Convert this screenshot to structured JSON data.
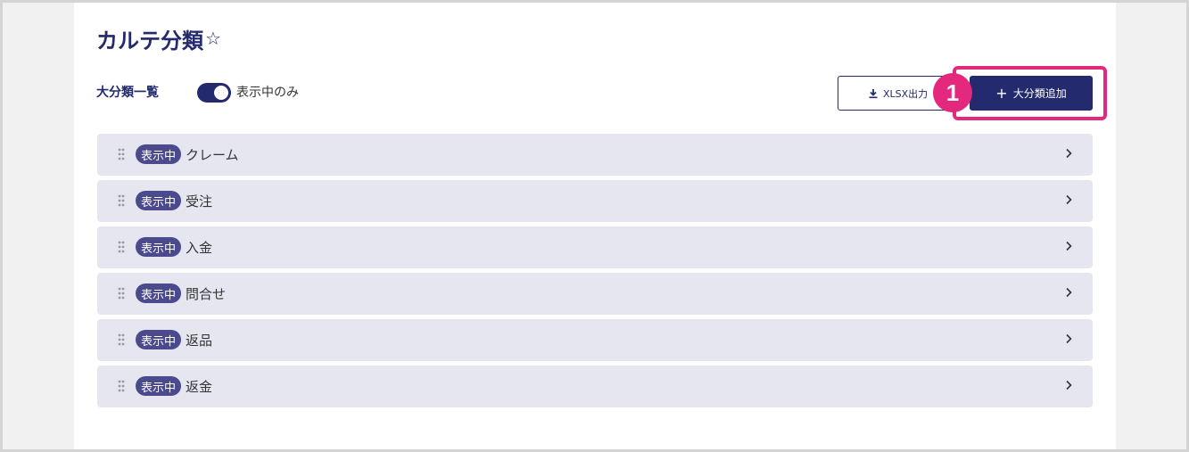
{
  "page": {
    "title": "カルテ分類",
    "star_icon": "☆"
  },
  "toolbar": {
    "list_heading": "大分類一覧",
    "toggle_label": "表示中のみ",
    "toggle_on": true,
    "xlsx_button_label": "XLSX出力",
    "add_button_label": "大分類追加",
    "step_number": "1"
  },
  "categories": [
    {
      "status": "表示中",
      "label": "クレーム"
    },
    {
      "status": "表示中",
      "label": "受注"
    },
    {
      "status": "表示中",
      "label": "入金"
    },
    {
      "status": "表示中",
      "label": "問合せ"
    },
    {
      "status": "表示中",
      "label": "返品"
    },
    {
      "status": "表示中",
      "label": "返金"
    }
  ],
  "colors": {
    "primary": "#232a6e",
    "highlight": "#e4287e",
    "row_background": "#e6e6f1",
    "badge": "#4a4a8c"
  },
  "icons": [
    "star-icon",
    "download-icon",
    "plus-icon",
    "drag-handle-icon",
    "chevron-right-icon"
  ]
}
